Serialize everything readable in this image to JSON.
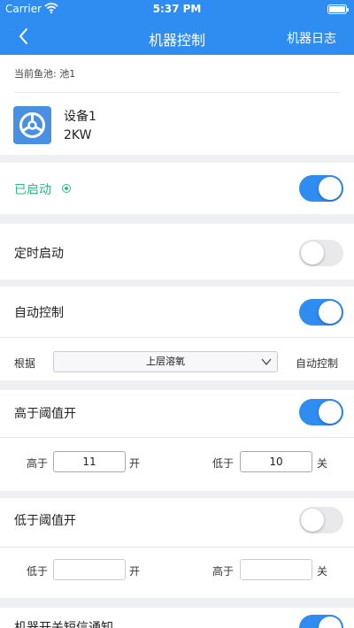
{
  "status": {
    "carrier": "Carrier",
    "time": "5:37 PM"
  },
  "nav": {
    "title": "机器控制",
    "right_label": "机器日志"
  },
  "pond": {
    "label": "当前鱼池: 池1"
  },
  "device": {
    "name": "设备1",
    "power": "2KW"
  },
  "running": {
    "label": "已启动",
    "on": true
  },
  "timer": {
    "label": "定时启动",
    "on": false
  },
  "auto": {
    "label": "自动控制",
    "on": true,
    "basis_label": "根据",
    "basis_value": "上层溶氧",
    "suffix": "自动控制"
  },
  "above": {
    "label": "高于阈值开",
    "on": true,
    "left_label": "高于",
    "left_value": "11",
    "left_unit": "开",
    "right_label": "低于",
    "right_value": "10",
    "right_unit": "关"
  },
  "below": {
    "label": "低于阈值开",
    "on": false,
    "left_label": "低于",
    "left_value": "",
    "left_unit": "开",
    "right_label": "高于",
    "right_value": "",
    "right_unit": "关"
  },
  "sms": {
    "label": "机器开关短信通知",
    "on": true
  },
  "colors": {
    "brand": "#2f8cf0",
    "green": "#2fb88a",
    "device_icon": "#4a90e2"
  }
}
